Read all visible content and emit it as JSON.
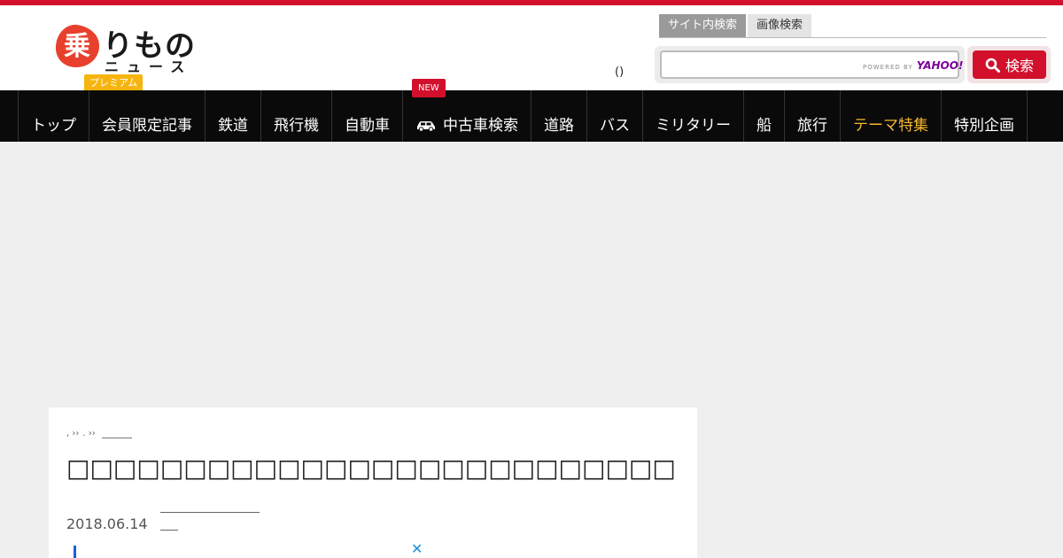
{
  "logo": {
    "badge_char": "乗",
    "text_top": "りもの",
    "text_bottom": "ニュース",
    "premium": "プレミアム",
    "brand_color": "#d2102c"
  },
  "header": {
    "paren_text": "()"
  },
  "search": {
    "tabs": [
      "サイト内検索",
      "画像検索"
    ],
    "active_tab": 0,
    "input_value": "",
    "powered_by": "POWERED BY",
    "powered_brand": "YAHOO!",
    "button_label": "検索",
    "icon": "search-icon"
  },
  "nav": {
    "items": [
      {
        "label": "トップ"
      },
      {
        "label": "会員限定記事"
      },
      {
        "label": "鉄道"
      },
      {
        "label": "飛行機"
      },
      {
        "label": "自動車"
      },
      {
        "label": "中古車検索",
        "icon": "car-icon"
      },
      {
        "label": "道路"
      },
      {
        "label": "バス"
      },
      {
        "label": "ミリタリー"
      },
      {
        "label": "船"
      },
      {
        "label": "旅行"
      },
      {
        "label": "テーマ特集",
        "highlight": true
      },
      {
        "label": "特別企画"
      }
    ],
    "new_badge": "NEW",
    "highlight_color": "#f5b82e"
  },
  "article": {
    "breadcrumb": [
      ", ›› ",
      ". ›› "
    ],
    "title": "□□□□□□□□□□□□□□□□□□□□□□□□□□□□□□□□□□□□□□□□□□□□",
    "date": "2018.06.14",
    "ad_close": "✕"
  }
}
